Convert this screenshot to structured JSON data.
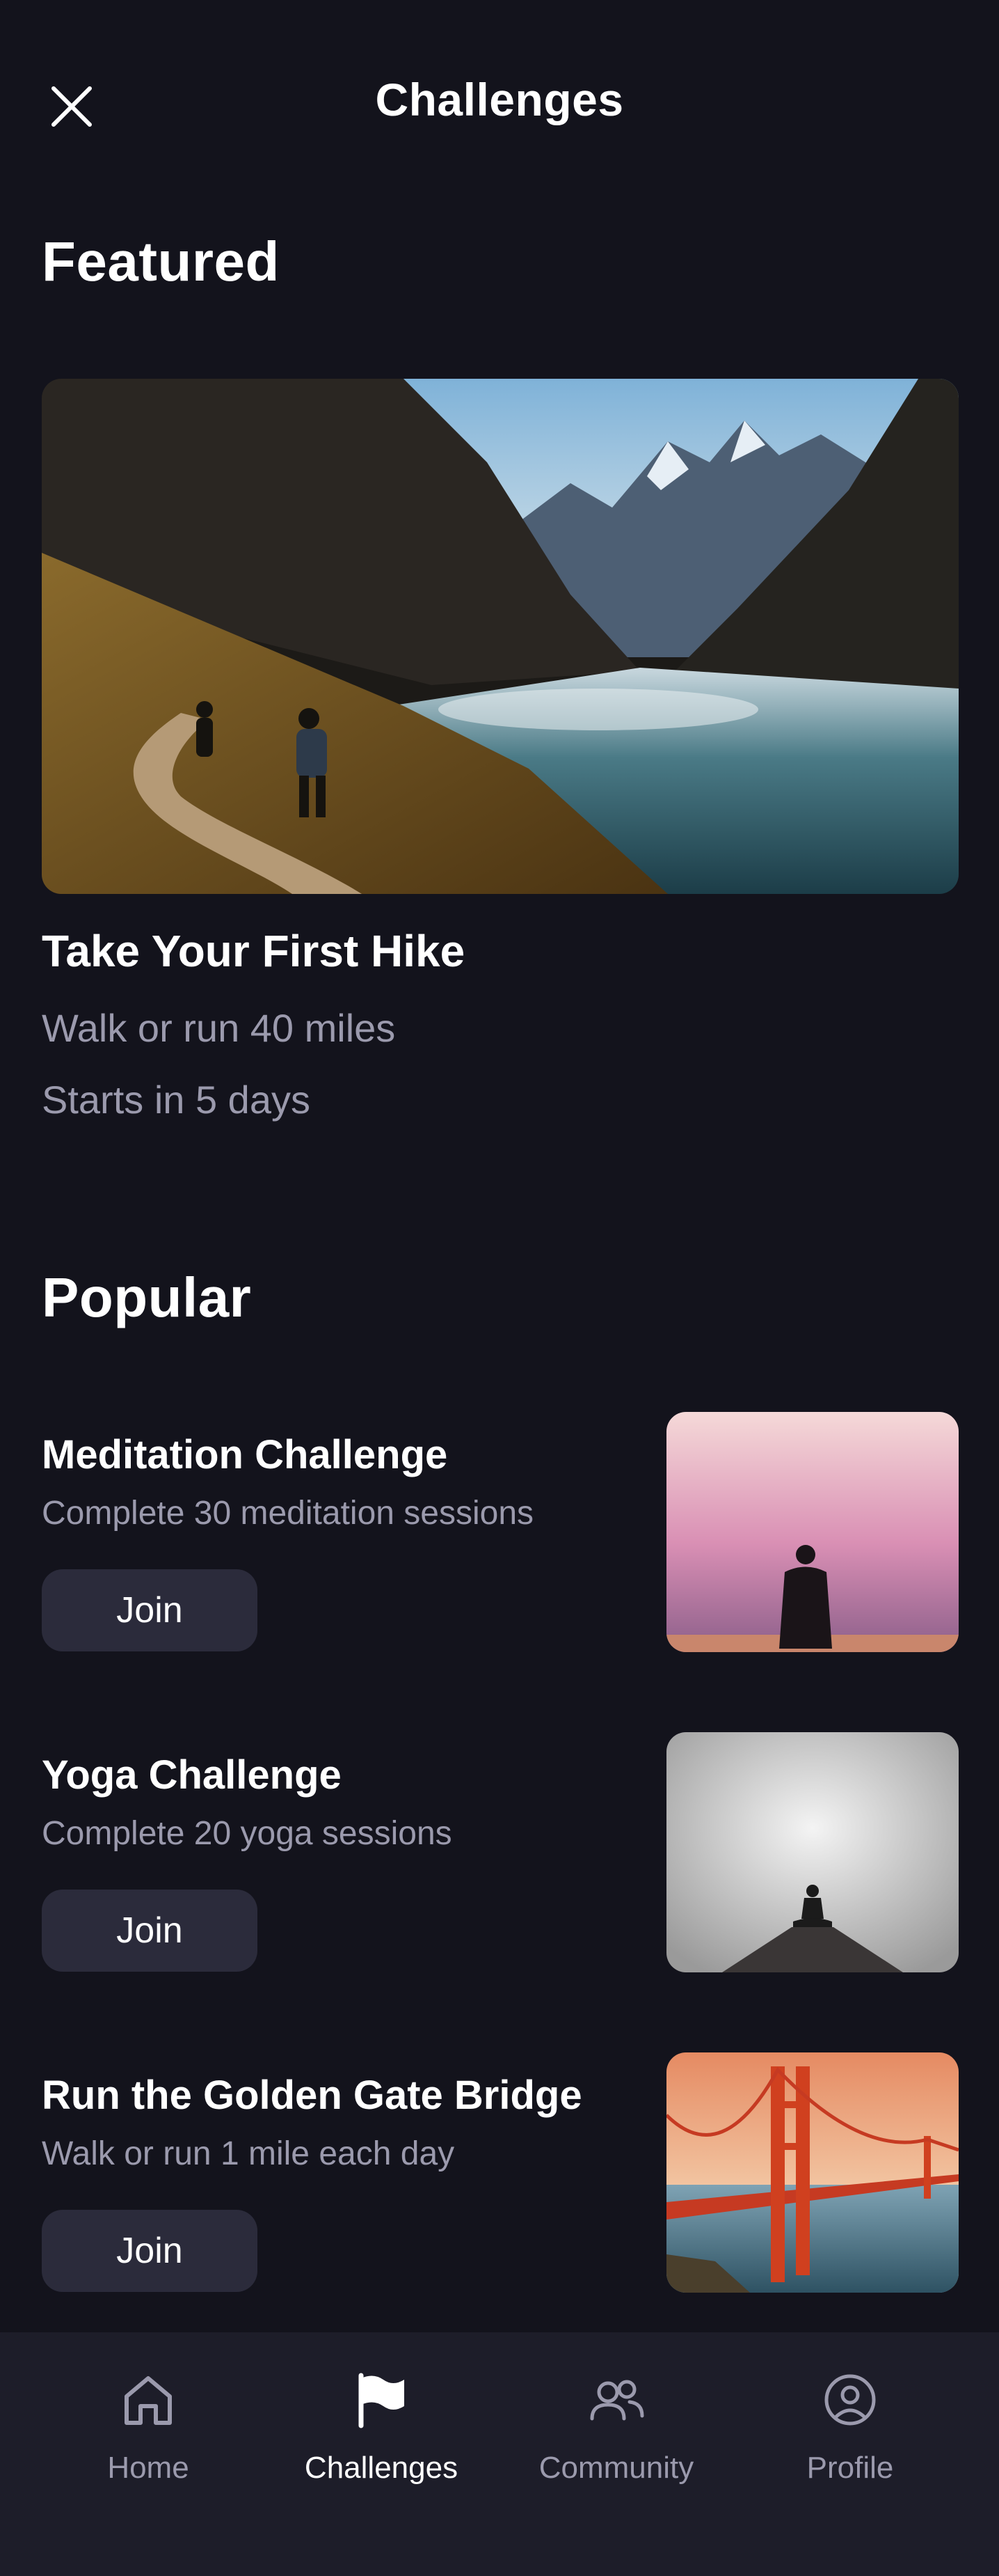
{
  "header": {
    "title": "Challenges"
  },
  "featured": {
    "section_title": "Featured",
    "card": {
      "title": "Take Your First Hike",
      "subtitle": "Walk or run 40 miles",
      "starts": "Starts in 5 days"
    }
  },
  "popular": {
    "section_title": "Popular",
    "items": [
      {
        "title": "Meditation Challenge",
        "description": "Complete 30 meditation sessions",
        "button": "Join"
      },
      {
        "title": "Yoga Challenge",
        "description": "Complete 20 yoga sessions",
        "button": "Join"
      },
      {
        "title": "Run the Golden Gate Bridge",
        "description": "Walk or run 1 mile each day",
        "button": "Join"
      }
    ]
  },
  "nav": {
    "items": [
      {
        "label": "Home",
        "icon": "home-icon"
      },
      {
        "label": "Challenges",
        "icon": "flag-icon",
        "active": true
      },
      {
        "label": "Community",
        "icon": "users-icon"
      },
      {
        "label": "Profile",
        "icon": "profile-icon"
      }
    ]
  },
  "colors": {
    "background": "#13131c",
    "nav_background": "#1d1d29",
    "button_background": "#2b2b3b",
    "muted_text": "#9b9aad",
    "active_text": "#ffffff"
  }
}
